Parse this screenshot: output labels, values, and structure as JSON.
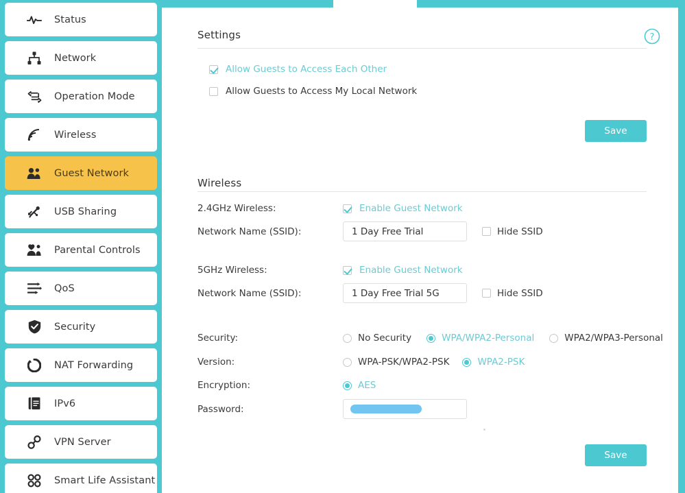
{
  "sidebar": {
    "items": [
      {
        "label": "Status",
        "icon": "pulse-icon",
        "active": false
      },
      {
        "label": "Network",
        "icon": "network-tree-icon",
        "active": false
      },
      {
        "label": "Operation Mode",
        "icon": "swap-arrows-icon",
        "active": false
      },
      {
        "label": "Wireless",
        "icon": "wifi-signal-icon",
        "active": false
      },
      {
        "label": "Guest Network",
        "icon": "people-icon",
        "active": true
      },
      {
        "label": "USB Sharing",
        "icon": "usb-icon",
        "active": false
      },
      {
        "label": "Parental Controls",
        "icon": "parental-icon",
        "active": false
      },
      {
        "label": "QoS",
        "icon": "qos-arrows-icon",
        "active": false
      },
      {
        "label": "Security",
        "icon": "shield-icon",
        "active": false
      },
      {
        "label": "NAT Forwarding",
        "icon": "refresh-circle-icon",
        "active": false
      },
      {
        "label": "IPv6",
        "icon": "document-icon",
        "active": false
      },
      {
        "label": "VPN Server",
        "icon": "link-icon",
        "active": false
      },
      {
        "label": "Smart Life Assistant",
        "icon": "grid-squares-icon",
        "active": false
      }
    ]
  },
  "header": {
    "help_icon": "help-circle-icon"
  },
  "settings_section": {
    "title": "Settings",
    "checkboxes": [
      {
        "label": "Allow Guests to Access Each Other",
        "checked": true
      },
      {
        "label": "Allow Guests to Access My Local Network",
        "checked": false
      }
    ],
    "save_label": "Save"
  },
  "wireless_section": {
    "title": "Wireless",
    "band_24": {
      "label": "2.4GHz Wireless:",
      "enable_label": "Enable Guest Network",
      "enable_checked": true,
      "ssid_label": "Network Name (SSID):",
      "ssid_value": "1 Day Free Trial",
      "hide_ssid_label": "Hide SSID",
      "hide_ssid_checked": false
    },
    "band_5": {
      "label": "5GHz Wireless:",
      "enable_label": "Enable Guest Network",
      "enable_checked": true,
      "ssid_label": "Network Name (SSID):",
      "ssid_value": "1 Day Free Trial 5G",
      "hide_ssid_label": "Hide SSID",
      "hide_ssid_checked": false
    },
    "security": {
      "label": "Security:",
      "options": [
        {
          "label": "No Security",
          "selected": false
        },
        {
          "label": "WPA/WPA2-Personal",
          "selected": true
        },
        {
          "label": "WPA2/WPA3-Personal",
          "selected": false
        }
      ]
    },
    "version": {
      "label": "Version:",
      "options": [
        {
          "label": "WPA-PSK/WPA2-PSK",
          "selected": false
        },
        {
          "label": "WPA2-PSK",
          "selected": true
        }
      ]
    },
    "encryption": {
      "label": "Encryption:",
      "options": [
        {
          "label": "AES",
          "selected": true
        }
      ]
    },
    "password": {
      "label": "Password:",
      "value": "",
      "redacted": true
    },
    "save_label": "Save"
  },
  "colors": {
    "teal": "#4BC8D0",
    "amber": "#F7C24A",
    "teal_text": "#6dcad2",
    "redaction_blue": "#71c5f0"
  }
}
